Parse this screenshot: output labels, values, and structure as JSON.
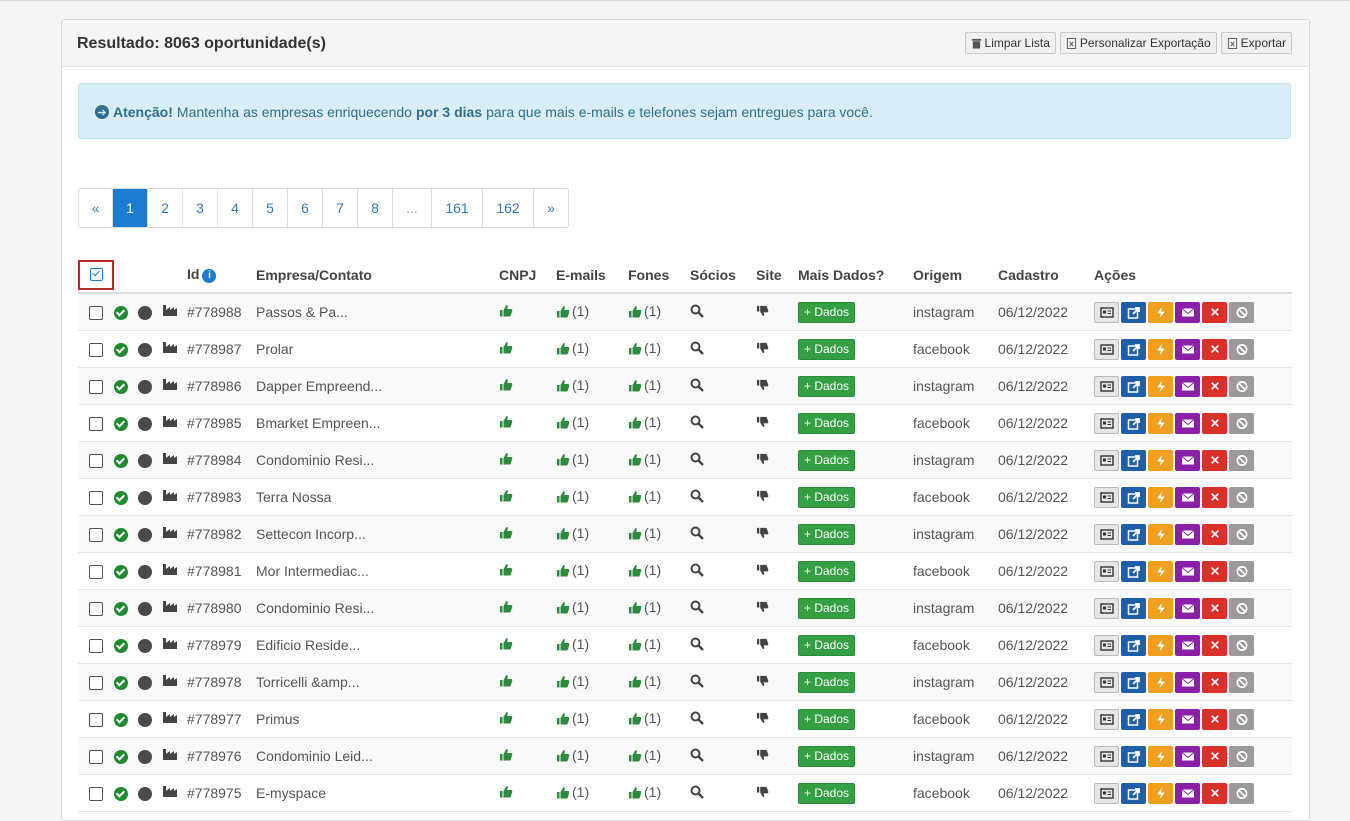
{
  "panel": {
    "title": "Resultado: 8063 oportunidade(s)",
    "buttons": {
      "clear": "Limpar Lista",
      "customize": "Personalizar Exportação",
      "export": "Exportar"
    }
  },
  "alert": {
    "strong": "Atenção!",
    "text1": "Mantenha as empresas enriquecendo",
    "bold": "por 3 dias",
    "text2": "para que mais e-mails e telefones sejam entregues para você."
  },
  "pagination": {
    "prev": "«",
    "pages": [
      "1",
      "2",
      "3",
      "4",
      "5",
      "6",
      "7",
      "8",
      "...",
      "161",
      "162"
    ],
    "next": "»",
    "active": "1"
  },
  "table": {
    "headers": {
      "id": "Id",
      "company": "Empresa/Contato",
      "cnpj": "CNPJ",
      "emails": "E-mails",
      "phones": "Fones",
      "partners": "Sócios",
      "site": "Site",
      "more": "Mais Dados?",
      "origin": "Origem",
      "created": "Cadastro",
      "actions": "Ações"
    },
    "dados_label": "+ Dados",
    "count_label": "(1)",
    "rows": [
      {
        "id": "#778988",
        "company": "Passos & Pa...",
        "origin": "instagram",
        "date": "06/12/2022"
      },
      {
        "id": "#778987",
        "company": "Prolar",
        "origin": "facebook",
        "date": "06/12/2022"
      },
      {
        "id": "#778986",
        "company": "Dapper Empreend...",
        "origin": "instagram",
        "date": "06/12/2022"
      },
      {
        "id": "#778985",
        "company": "Bmarket Empreen...",
        "origin": "facebook",
        "date": "06/12/2022"
      },
      {
        "id": "#778984",
        "company": "Condominio Resi...",
        "origin": "instagram",
        "date": "06/12/2022"
      },
      {
        "id": "#778983",
        "company": "Terra Nossa",
        "origin": "facebook",
        "date": "06/12/2022"
      },
      {
        "id": "#778982",
        "company": "Settecon Incorp...",
        "origin": "instagram",
        "date": "06/12/2022"
      },
      {
        "id": "#778981",
        "company": "Mor Intermediac...",
        "origin": "facebook",
        "date": "06/12/2022"
      },
      {
        "id": "#778980",
        "company": "Condominio Resi...",
        "origin": "instagram",
        "date": "06/12/2022"
      },
      {
        "id": "#778979",
        "company": "Edificio Reside...",
        "origin": "facebook",
        "date": "06/12/2022"
      },
      {
        "id": "#778978",
        "company": "Torricelli &amp...",
        "origin": "instagram",
        "date": "06/12/2022"
      },
      {
        "id": "#778977",
        "company": "Primus",
        "origin": "facebook",
        "date": "06/12/2022"
      },
      {
        "id": "#778976",
        "company": "Condominio Leid...",
        "origin": "instagram",
        "date": "06/12/2022"
      },
      {
        "id": "#778975",
        "company": "E-myspace",
        "origin": "facebook",
        "date": "06/12/2022"
      }
    ]
  }
}
